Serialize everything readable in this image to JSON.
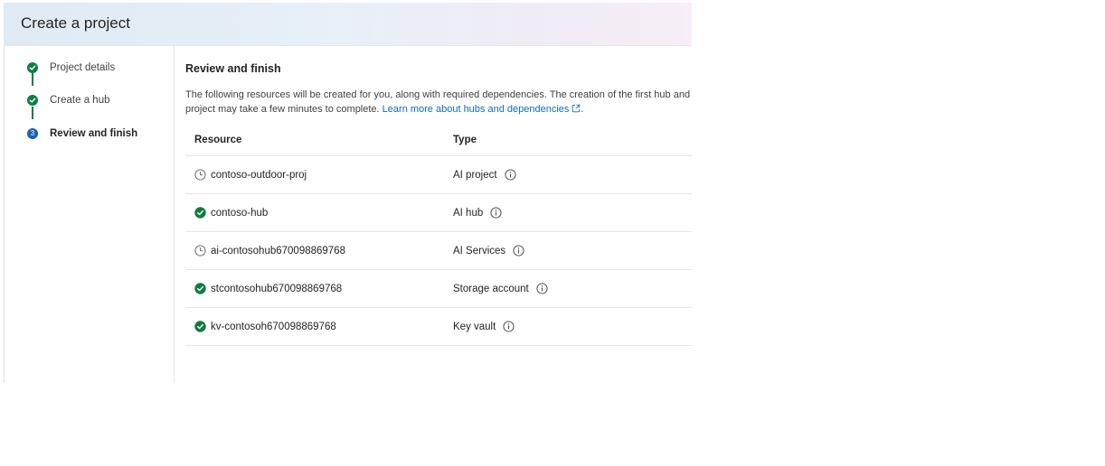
{
  "header": {
    "title": "Create a project"
  },
  "steps": [
    {
      "label": "Project details",
      "state": "done"
    },
    {
      "label": "Create a hub",
      "state": "done"
    },
    {
      "label": "Review and finish",
      "state": "current",
      "number": "3"
    }
  ],
  "review": {
    "title": "Review and finish",
    "description": "The following resources will be created for you, along with required dependencies. The creation of the first hub and project may take a few minutes to complete.",
    "link_text": "Learn more about hubs and dependencies",
    "period": "."
  },
  "table": {
    "headers": [
      "Resource",
      "Type"
    ],
    "rows": [
      {
        "resource": "contoso-outdoor-proj",
        "status": "pending",
        "type": "AI project"
      },
      {
        "resource": "contoso-hub",
        "status": "done",
        "type": "AI hub"
      },
      {
        "resource": "ai-contosohub670098869768",
        "status": "pending",
        "type": "AI Services"
      },
      {
        "resource": "stcontosohub670098869768",
        "status": "done",
        "type": "Storage account"
      },
      {
        "resource": "kv-contosoh670098869768",
        "status": "done",
        "type": "Key vault"
      }
    ]
  },
  "icons": {
    "done": "checkmark-circle-icon",
    "pending": "clock-icon",
    "info": "info-icon",
    "external": "external-link-icon"
  },
  "colors": {
    "success": "#107c41",
    "current_step": "#1a5fb4",
    "link": "#0f6cbd"
  }
}
